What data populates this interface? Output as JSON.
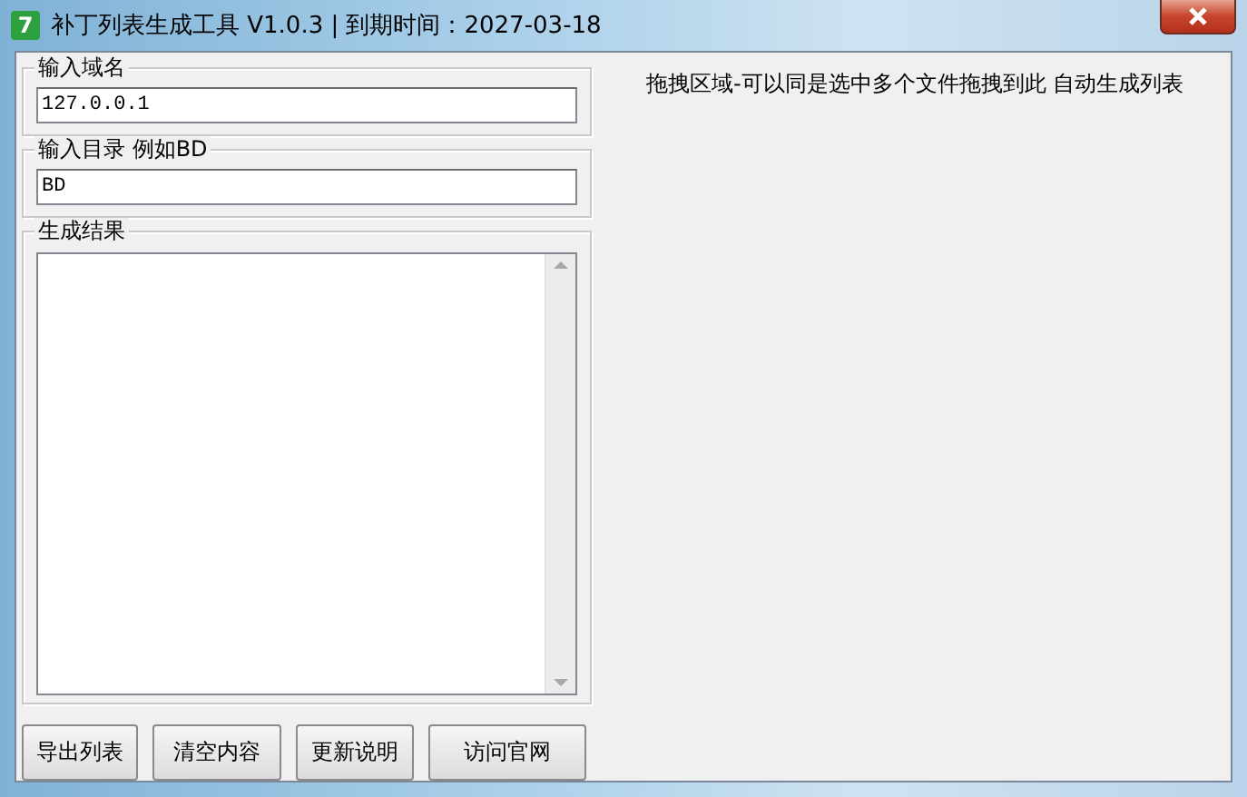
{
  "window": {
    "icon_text": "7",
    "title": "补丁列表生成工具 V1.0.3 | 到期时间：2027-03-18"
  },
  "groups": [
    {
      "kind": "input",
      "label": "输入域名",
      "value": "127.0.0.1"
    },
    {
      "kind": "input",
      "label": "输入目录 例如BD",
      "value": "BD"
    },
    {
      "kind": "textarea",
      "label": "生成结果"
    }
  ],
  "buttons": [
    "导出列表",
    "清空内容",
    "更新说明",
    "访问官网"
  ],
  "drop_hint": "拖拽区域-可以同是选中多个文件拖拽到此 自动生成列表"
}
